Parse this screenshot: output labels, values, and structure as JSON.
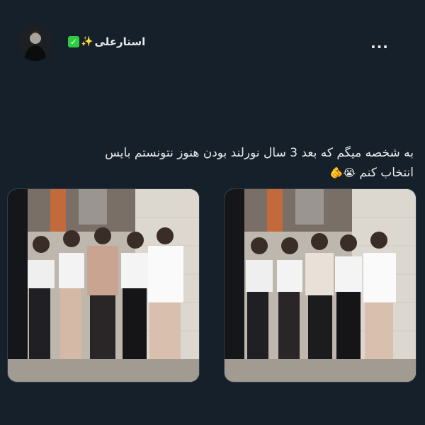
{
  "tweet": {
    "author": {
      "display_name": "استارعلی",
      "name_emoji": "✨",
      "verified_emoji": "✅",
      "avatar_icon": "profile-photo"
    },
    "more_label": "...",
    "text_line1": "به شخصه میگم که بعد 3 سال نورلند بودن هنوز نتونستم بایس",
    "text_line2": "انتخاب کنم",
    "text_emojis": "😭🫵",
    "media": [
      {
        "icon": "group-photo",
        "blurred": true
      },
      {
        "icon": "group-photo",
        "blurred": true
      }
    ]
  },
  "colors": {
    "background": "#15202b",
    "text": "#e7e9ea"
  }
}
